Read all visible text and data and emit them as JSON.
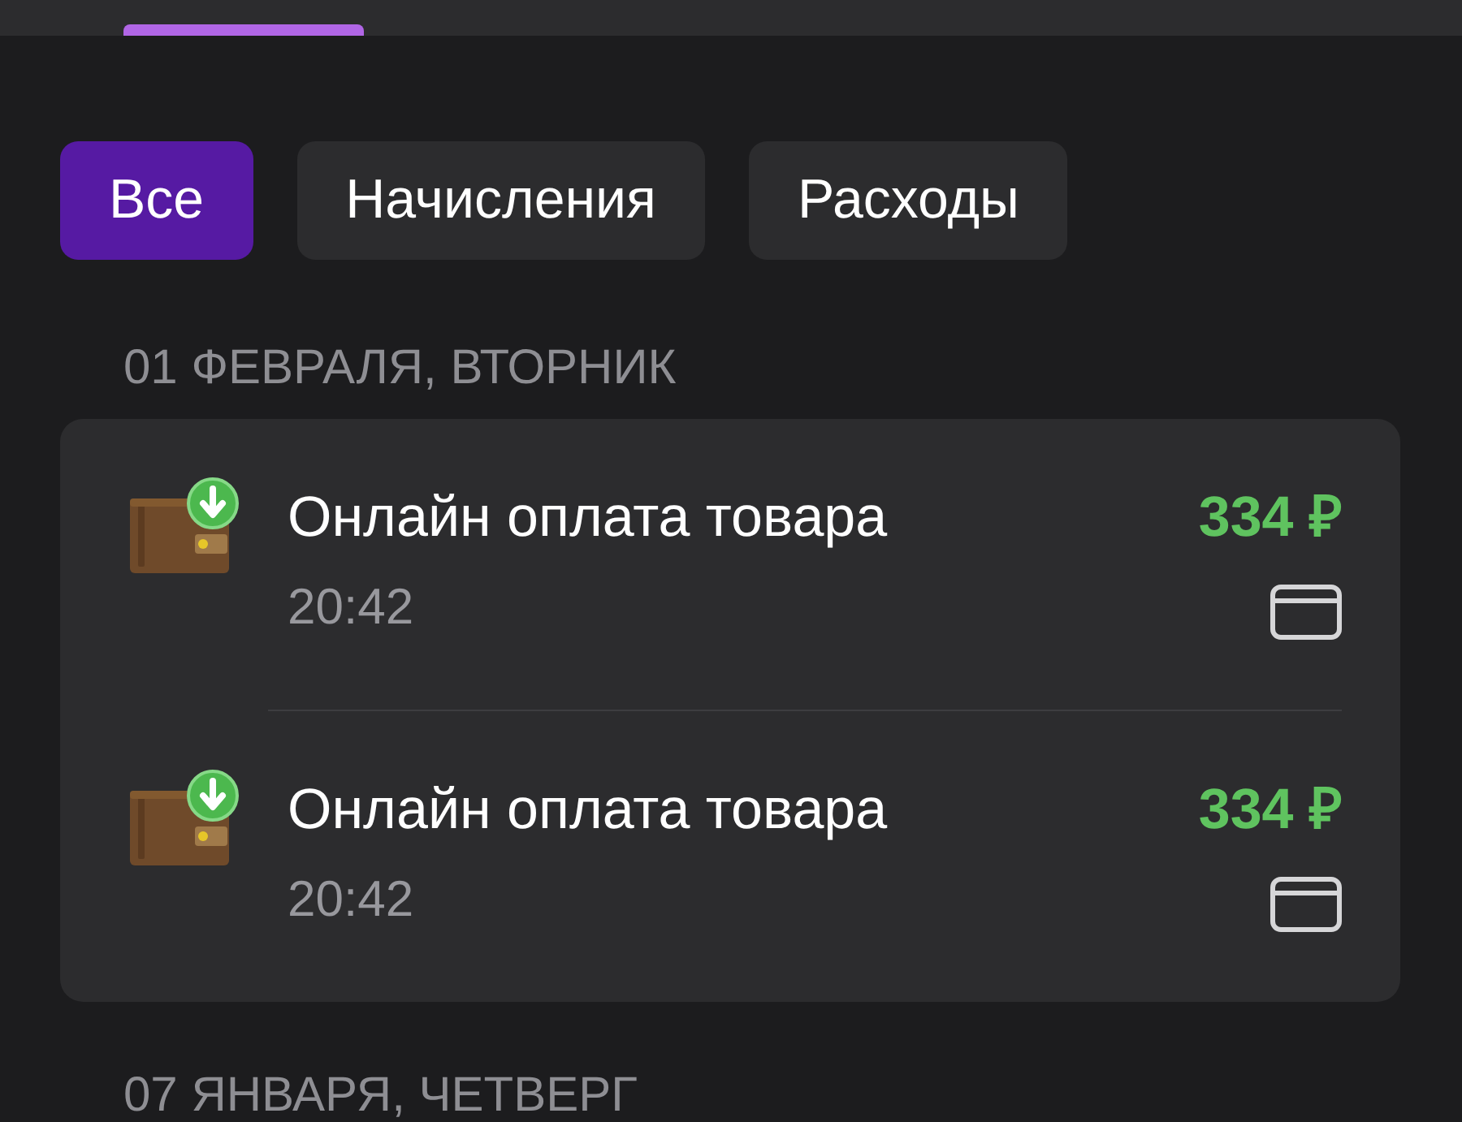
{
  "filters": [
    {
      "label": "Все",
      "selected": true
    },
    {
      "label": "Начисления",
      "selected": false
    },
    {
      "label": "Расходы",
      "selected": false
    }
  ],
  "groups": [
    {
      "date": "01 ФЕВРАЛЯ, ВТОРНИК",
      "transactions": [
        {
          "title": "Онлайн оплата товара",
          "time": "20:42",
          "amount": "334 ₽"
        },
        {
          "title": "Онлайн оплата товара",
          "time": "20:42",
          "amount": "334 ₽"
        }
      ]
    },
    {
      "date": "07 ЯНВАРЯ, ЧЕТВЕРГ"
    }
  ]
}
